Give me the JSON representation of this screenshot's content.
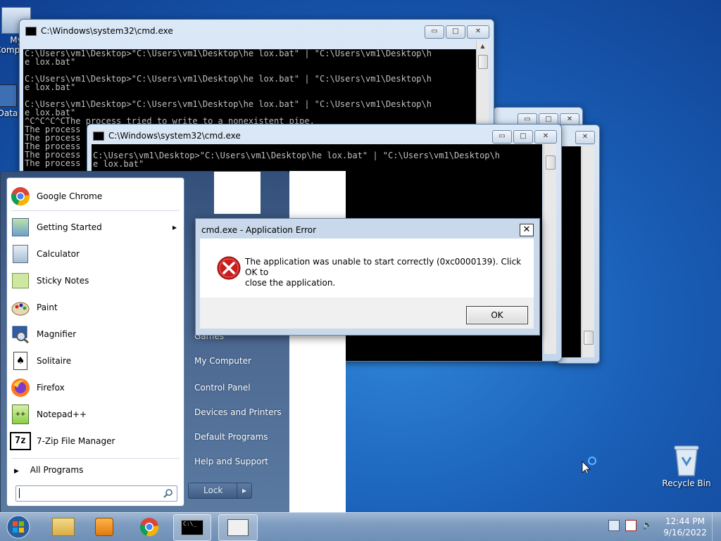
{
  "desktop": {
    "icons": [
      {
        "label": "My Computer"
      },
      {
        "label": "Data"
      },
      {
        "label": "Recycle Bin"
      }
    ]
  },
  "cmd_windows": [
    {
      "title": "C:\\Windows\\system32\\cmd.exe",
      "lines": "C:\\Users\\vm1\\Desktop>\"C:\\Users\\vm1\\Desktop\\he lox.bat\" | \"C:\\Users\\vm1\\Desktop\\h\ne lox.bat\"\n\nC:\\Users\\vm1\\Desktop>\"C:\\Users\\vm1\\Desktop\\he lox.bat\" | \"C:\\Users\\vm1\\Desktop\\h\ne lox.bat\"\n\nC:\\Users\\vm1\\Desktop>\"C:\\Users\\vm1\\Desktop\\he lox.bat\" | \"C:\\Users\\vm1\\Desktop\\h\ne lox.bat\"\n^C^C^C^CThe process tried to write to a nonexistent pipe.\nThe process\nThe process\nThe process\nThe process\nThe process"
    },
    {
      "title": "C:\\Windows\\system32\\cmd.exe",
      "lines": "C:\\Users\\vm1\\Desktop>\"C:\\Users\\vm1\\Desktop\\he lox.bat\" | \"C:\\Users\\vm1\\Desktop\\h\ne lox.bat\""
    }
  ],
  "controls": {
    "minimize": "▭",
    "maximize": "□",
    "close": "✕"
  },
  "start_menu": {
    "programs": [
      {
        "label": "Google Chrome",
        "icon": "chrome-icon"
      },
      {
        "label": "Getting Started",
        "icon": "getting-started-icon",
        "submenu_arrow": "▸"
      },
      {
        "label": "Calculator",
        "icon": "calculator-icon"
      },
      {
        "label": "Sticky Notes",
        "icon": "sticky-notes-icon"
      },
      {
        "label": "Paint",
        "icon": "paint-icon"
      },
      {
        "label": "Magnifier",
        "icon": "magnifier-icon"
      },
      {
        "label": "Solitaire",
        "icon": "solitaire-icon"
      },
      {
        "label": "Firefox",
        "icon": "firefox-icon"
      },
      {
        "label": "Notepad++",
        "icon": "notepadpp-icon"
      },
      {
        "label": "7-Zip File Manager",
        "icon": "7zip-icon"
      }
    ],
    "all_programs": "All Programs",
    "all_programs_arrow": "▶",
    "search_placeholder": "",
    "right_links": [
      "Games",
      "My Computer",
      "Control Panel",
      "Devices and Printers",
      "Default Programs",
      "Help and Support"
    ],
    "lock_label": "Lock",
    "lock_arrow": "▸"
  },
  "dialog": {
    "title": "cmd.exe - Application Error",
    "close": "✕",
    "message_line1": "The application was unable to start correctly (0xc0000139). Click OK to",
    "message_line2": "close the application.",
    "ok_label": "OK",
    "icon": "error-icon"
  },
  "taskbar": {
    "clock_time": "12:44 PM",
    "clock_date": "9/16/2022",
    "items": [
      "start-orb",
      "explorer",
      "media-player",
      "chrome",
      "cmd",
      "cmd-window"
    ]
  },
  "colors": {
    "accent": "#1a5fb8",
    "error": "#c81e1e"
  }
}
